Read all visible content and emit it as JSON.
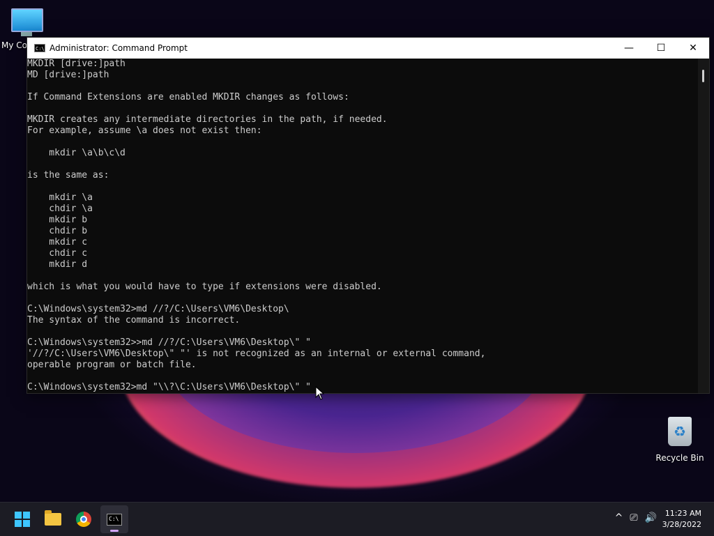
{
  "desktop": {
    "icons": [
      {
        "label": "My Co"
      },
      {
        "label": "Recycle Bin"
      }
    ]
  },
  "window": {
    "title": "Administrator: Command Prompt",
    "controls": {
      "minimize": "—",
      "maximize": "☐",
      "close": "✕"
    }
  },
  "console": {
    "lines": [
      "MKDIR [drive:]path",
      "MD [drive:]path",
      "",
      "If Command Extensions are enabled MKDIR changes as follows:",
      "",
      "MKDIR creates any intermediate directories in the path, if needed.",
      "For example, assume \\a does not exist then:",
      "",
      "    mkdir \\a\\b\\c\\d",
      "",
      "is the same as:",
      "",
      "    mkdir \\a",
      "    chdir \\a",
      "    mkdir b",
      "    chdir b",
      "    mkdir c",
      "    chdir c",
      "    mkdir d",
      "",
      "which is what you would have to type if extensions were disabled.",
      "",
      "C:\\Windows\\system32>md //?/C:\\Users\\VM6\\Desktop\\",
      "The syntax of the command is incorrect.",
      "",
      "C:\\Windows\\system32>>md //?/C:\\Users\\VM6\\Desktop\\\" \"",
      "'//?/C:\\Users\\VM6\\Desktop\\\" \"' is not recognized as an internal or external command,",
      "operable program or batch file.",
      "",
      "C:\\Windows\\system32>md \"\\\\?\\C:\\Users\\VM6\\Desktop\\\" \""
    ]
  },
  "taskbar": {
    "buttons": [
      {
        "name": "start",
        "icon": "windows-logo-icon"
      },
      {
        "name": "file-explorer",
        "icon": "folder-icon"
      },
      {
        "name": "chrome",
        "icon": "chrome-icon"
      },
      {
        "name": "command-prompt",
        "icon": "terminal-icon",
        "active": true
      }
    ],
    "tray": {
      "chevron": "^",
      "network": "⎚",
      "volume": "🔊"
    },
    "clock": {
      "time": "11:23 AM",
      "date": "3/28/2022"
    }
  },
  "colors": {
    "console_bg": "#0c0c0c",
    "console_fg": "#cccccc",
    "taskbar_bg": "#1c1c24",
    "accent": "#3ec6ff"
  }
}
